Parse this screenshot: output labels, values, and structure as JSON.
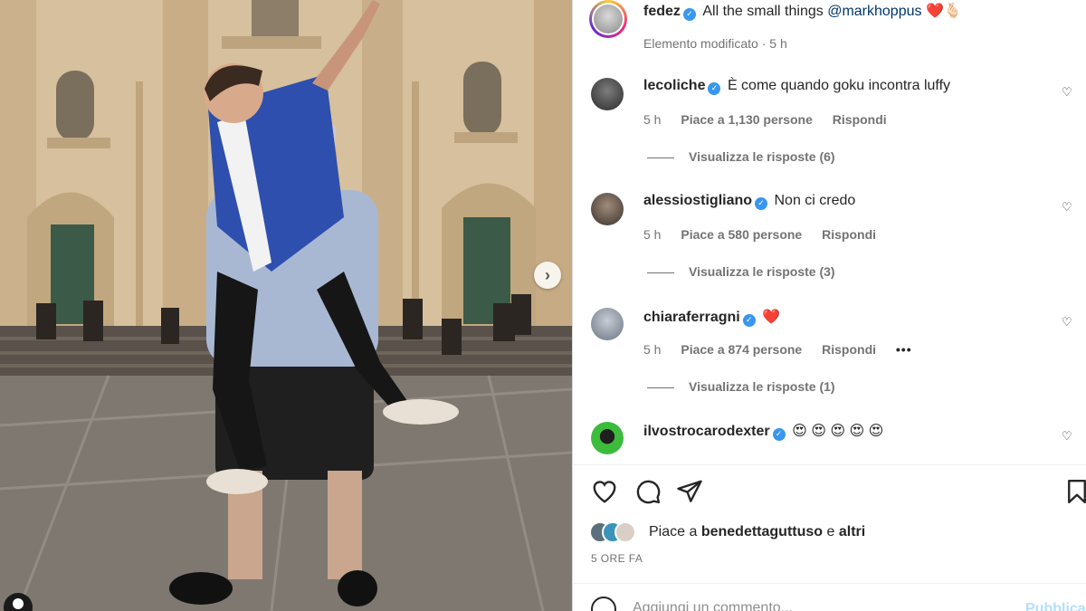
{
  "post": {
    "author": "fedez",
    "caption_text": "All the small things",
    "caption_mention": "@markhoppus",
    "caption_emoji": "❤️🫰🏻",
    "edited_label": "Elemento modificato",
    "edited_sep": "·",
    "edited_time": "5 h"
  },
  "comments": [
    {
      "username": "lecoliche",
      "verified": true,
      "text": "È come quando goku incontra luffy",
      "time": "5 h",
      "likes": "Piace a 1,130 persone",
      "reply": "Rispondi",
      "more": "",
      "replies": "Visualizza le risposte (6)"
    },
    {
      "username": "alessiostigliano",
      "verified": true,
      "text": "Non ci credo",
      "time": "5 h",
      "likes": "Piace a 580 persone",
      "reply": "Rispondi",
      "more": "",
      "replies": "Visualizza le risposte (3)"
    },
    {
      "username": "chiaraferragni",
      "verified": true,
      "text": "❤️",
      "time": "5 h",
      "likes": "Piace a 874 persone",
      "reply": "Rispondi",
      "more": "•••",
      "replies": "Visualizza le risposte (1)"
    },
    {
      "username": "ilvostrocarodexter",
      "verified": true,
      "text": "😍 😍 😍 😍 😍",
      "time": "",
      "likes": "",
      "reply": "",
      "more": "",
      "replies": ""
    }
  ],
  "likes_summary": {
    "prefix": "Piace a",
    "user": "benedettaguttuso",
    "join": "e",
    "suffix": "altri"
  },
  "time_ago": "5 ORE FA",
  "add_comment": {
    "placeholder": "Aggiungi un commento...",
    "publish": "Pubblica"
  },
  "icons": {
    "like": "heart-icon",
    "comment": "comment-bubble-icon",
    "share": "paper-plane-icon",
    "save": "bookmark-icon",
    "emoji": "smiley-icon",
    "next": "chevron-right-icon",
    "tag": "user-tag-icon",
    "verified": "verified-badge-icon"
  },
  "colors": {
    "verified": "#3897f0",
    "mention": "#00376b",
    "muted": "#737373",
    "publish": "#b2dffc",
    "heart": "#ed4956"
  }
}
